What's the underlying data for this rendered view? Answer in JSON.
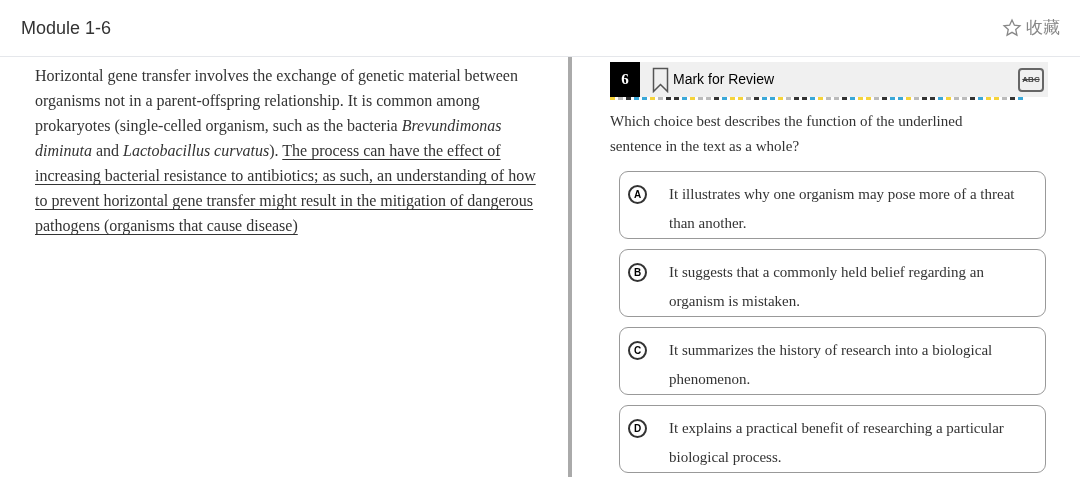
{
  "header": {
    "title": "Module 1-6",
    "favorite_label": "收藏"
  },
  "passage": {
    "text": "Horizontal gene transfer involves the exchange of genetic material between organisms not in a parent-offspring relationship. It is common among prokaryotes (single-celled organism, such as the bacteria *Brevundimonas diminuta* and *Lactobacillus curvatus*). ",
    "underlined_text": "The process can have the effect of increasing bacterial resistance to antibiotics; as such, an understanding of how to prevent horizontal gene transfer might result in the mitigation of dangerous pathogens (organisms that cause disease)"
  },
  "question": {
    "number": "6",
    "mark_for_review": "Mark for Review",
    "abc_tool": "ABC",
    "prompt": "Which choice best describes the function of the underlined sentence in the text as a whole?",
    "choices": [
      {
        "letter": "A",
        "text": "It illustrates why one organism may pose more of a threat than another."
      },
      {
        "letter": "B",
        "text": "It suggests that a commonly held belief regarding an organism is mistaken."
      },
      {
        "letter": "C",
        "text": "It summarizes the history of research into a biological phenomenon."
      },
      {
        "letter": "D",
        "text": "It explains a practical benefit of researching a particular biological process."
      }
    ]
  }
}
